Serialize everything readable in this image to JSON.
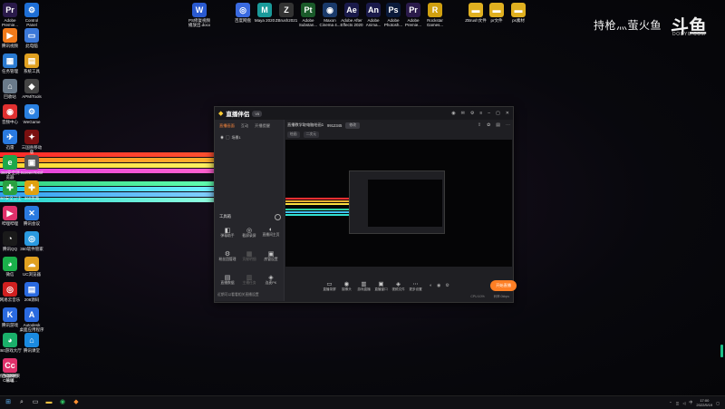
{
  "watermark": {
    "text": "持枪灬萤火鱼",
    "logo": "斗鱼",
    "logo_sub": "DOUYU.COM"
  },
  "desktop_icons": [
    {
      "label": "Adobe\nPremie...",
      "color": "#2a1a4a",
      "glyph": "Pr"
    },
    {
      "label": "Control\nPanel",
      "color": "#1e6fd6",
      "glyph": "⚙"
    },
    {
      "label": "腾讯视频",
      "color": "#f07a1b",
      "glyph": "▶"
    },
    {
      "label": "此电脑",
      "color": "#3b78d8",
      "glyph": "▭"
    },
    {
      "label": "任务管理",
      "color": "#2a7ad0",
      "glyph": "▦"
    },
    {
      "label": "系统工具",
      "color": "#e0a020",
      "glyph": "▤"
    },
    {
      "label": "回收站",
      "color": "#6a7a8a",
      "glyph": "⌂"
    },
    {
      "label": "APM/Tools",
      "color": "#444",
      "glyph": "◆"
    },
    {
      "label": "音频中心",
      "color": "#e03030",
      "glyph": "◉"
    },
    {
      "label": "WeGame",
      "color": "#2a80e0",
      "glyph": "⚙"
    },
    {
      "label": "迅雷",
      "color": "#2a7ae0",
      "glyph": "✈"
    },
    {
      "label": "三国杀移动\n版",
      "color": "#7a1010",
      "glyph": "✦"
    },
    {
      "label": "360安全浏\n览器",
      "color": "#1da84a",
      "glyph": "e"
    },
    {
      "label": "ScreenToGif",
      "color": "#555",
      "glyph": "▣"
    },
    {
      "label": "360安全卫士",
      "color": "#2aa040",
      "glyph": "✚"
    },
    {
      "label": "360杀毒",
      "color": "#e0a010",
      "glyph": "✚"
    },
    {
      "label": "哔哩哔哩",
      "color": "#e0306a",
      "glyph": "▶"
    },
    {
      "label": "腾讯会议",
      "color": "#2a7ae0",
      "glyph": "✕"
    },
    {
      "label": "腾讯QQ",
      "color": "#1a1a1a",
      "glyph": "◔"
    },
    {
      "label": "360软件管家",
      "color": "#2a9ae0",
      "glyph": "◎"
    },
    {
      "label": "微信",
      "color": "#1ab04a",
      "glyph": "◕"
    },
    {
      "label": "UC浏览器",
      "color": "#e0a020",
      "glyph": "☁"
    },
    {
      "label": "网易云音乐",
      "color": "#d02020",
      "glyph": "◎"
    },
    {
      "label": "208源码",
      "color": "#2a6ae0",
      "glyph": "▤"
    },
    {
      "label": "腾讯游戏",
      "color": "#2a6ae0",
      "glyph": "K"
    },
    {
      "label": "Autodesk\n桌面应用程序",
      "color": "#2a6ae0",
      "glyph": "A"
    },
    {
      "label": "360游戏大厅",
      "color": "#1ab06a",
      "glyph": "◕"
    },
    {
      "label": "腾讯课堂",
      "color": "#1a8ae0",
      "glyph": "⌂"
    },
    {
      "label": "保护文件夹\n管理",
      "color": "#1ab04a",
      "glyph": "⬤"
    },
    {
      "label": "百度网盘",
      "color": "#4a6ae0",
      "glyph": "◎"
    },
    {
      "label": "Adobe\nCreati...",
      "color": "#e0306a",
      "glyph": "Cc"
    }
  ],
  "top_icons": [
    {
      "label": "PS修复视频\n播放出.docx",
      "color": "#2a5ad0",
      "glyph": "W"
    },
    {
      "label": "百度网盘",
      "color": "#3a6ae0",
      "glyph": "◎"
    },
    {
      "label": "Maya 2020",
      "color": "#1a9a9a",
      "glyph": "M"
    },
    {
      "label": "ZBrush2021",
      "color": "#333",
      "glyph": "Z"
    },
    {
      "label": "Adobe\nSubstan...",
      "color": "#1a5a2a",
      "glyph": "Pt"
    },
    {
      "label": "Maxon\nCinema 4...",
      "color": "#1a3a6a",
      "glyph": "◉"
    },
    {
      "label": "Adobe After\nEffects 2020",
      "color": "#1a1a4a",
      "glyph": "Ae"
    },
    {
      "label": "Adobe\nAnima...",
      "color": "#1a1a4a",
      "glyph": "An"
    },
    {
      "label": "Adobe\nPhotosh...",
      "color": "#0a1a3a",
      "glyph": "Ps"
    },
    {
      "label": "Adobe\nPremie...",
      "color": "#2a1a4a",
      "glyph": "Pr"
    },
    {
      "label": "Rockstar\nGames...",
      "color": "#d0a010",
      "glyph": "R"
    },
    {
      "label": "ZBrush文件",
      "color": "#e0b020",
      "glyph": "▬"
    },
    {
      "label": "pr文件",
      "color": "#e0b020",
      "glyph": "▬"
    },
    {
      "label": "ps素材",
      "color": "#e0b020",
      "glyph": "▬"
    }
  ],
  "app": {
    "logo": "直播伴侣",
    "version": "V5",
    "tabs": [
      "直播画面",
      "互动",
      "开播提醒"
    ],
    "active_tab": "直播画面",
    "scene": "场景1",
    "tools_heading": "工具箱",
    "tools": [
      {
        "label": "弹幕助手",
        "icon": "◧",
        "dim": false
      },
      {
        "label": "截屏录屏",
        "icon": "◎",
        "dim": false
      },
      {
        "label": "直播间主页",
        "icon": "◐",
        "dim": false
      },
      {
        "label": "粉丝团管理",
        "icon": "⚙",
        "dim": false
      },
      {
        "label": "贡献明细",
        "icon": "▦",
        "dim": true
      },
      {
        "label": "房管设置",
        "icon": "▣",
        "dim": false
      },
      {
        "label": "直播数据",
        "icon": "▤",
        "dim": false
      },
      {
        "label": "主播任务",
        "icon": "▥",
        "dim": true
      },
      {
        "label": "连麦PK",
        "icon": "◈",
        "dim": false
      }
    ],
    "bottom_note": "近期可以看看相关直播设置",
    "room_title": "直播教学取电脑绘画1",
    "room_id": "9912345",
    "room_edit": "修改",
    "category_chip": "绘画",
    "category_chip2": "二次元",
    "bottom_tools": [
      {
        "label": "直播录屏",
        "icon": "▭"
      },
      {
        "label": "摄像头",
        "icon": "◉"
      },
      {
        "label": "游戏直播",
        "icon": "▥"
      },
      {
        "label": "直播窗口",
        "icon": "▣"
      },
      {
        "label": "视频文件",
        "icon": "◈"
      },
      {
        "label": "更多设置",
        "icon": "⋯"
      }
    ],
    "start_button": "开始直播",
    "status_cpu": "CPU:10%",
    "status_net": "码率:0kbps"
  },
  "taskbar": {
    "clock_time": "17:00",
    "clock_date": "2022/5/19"
  }
}
